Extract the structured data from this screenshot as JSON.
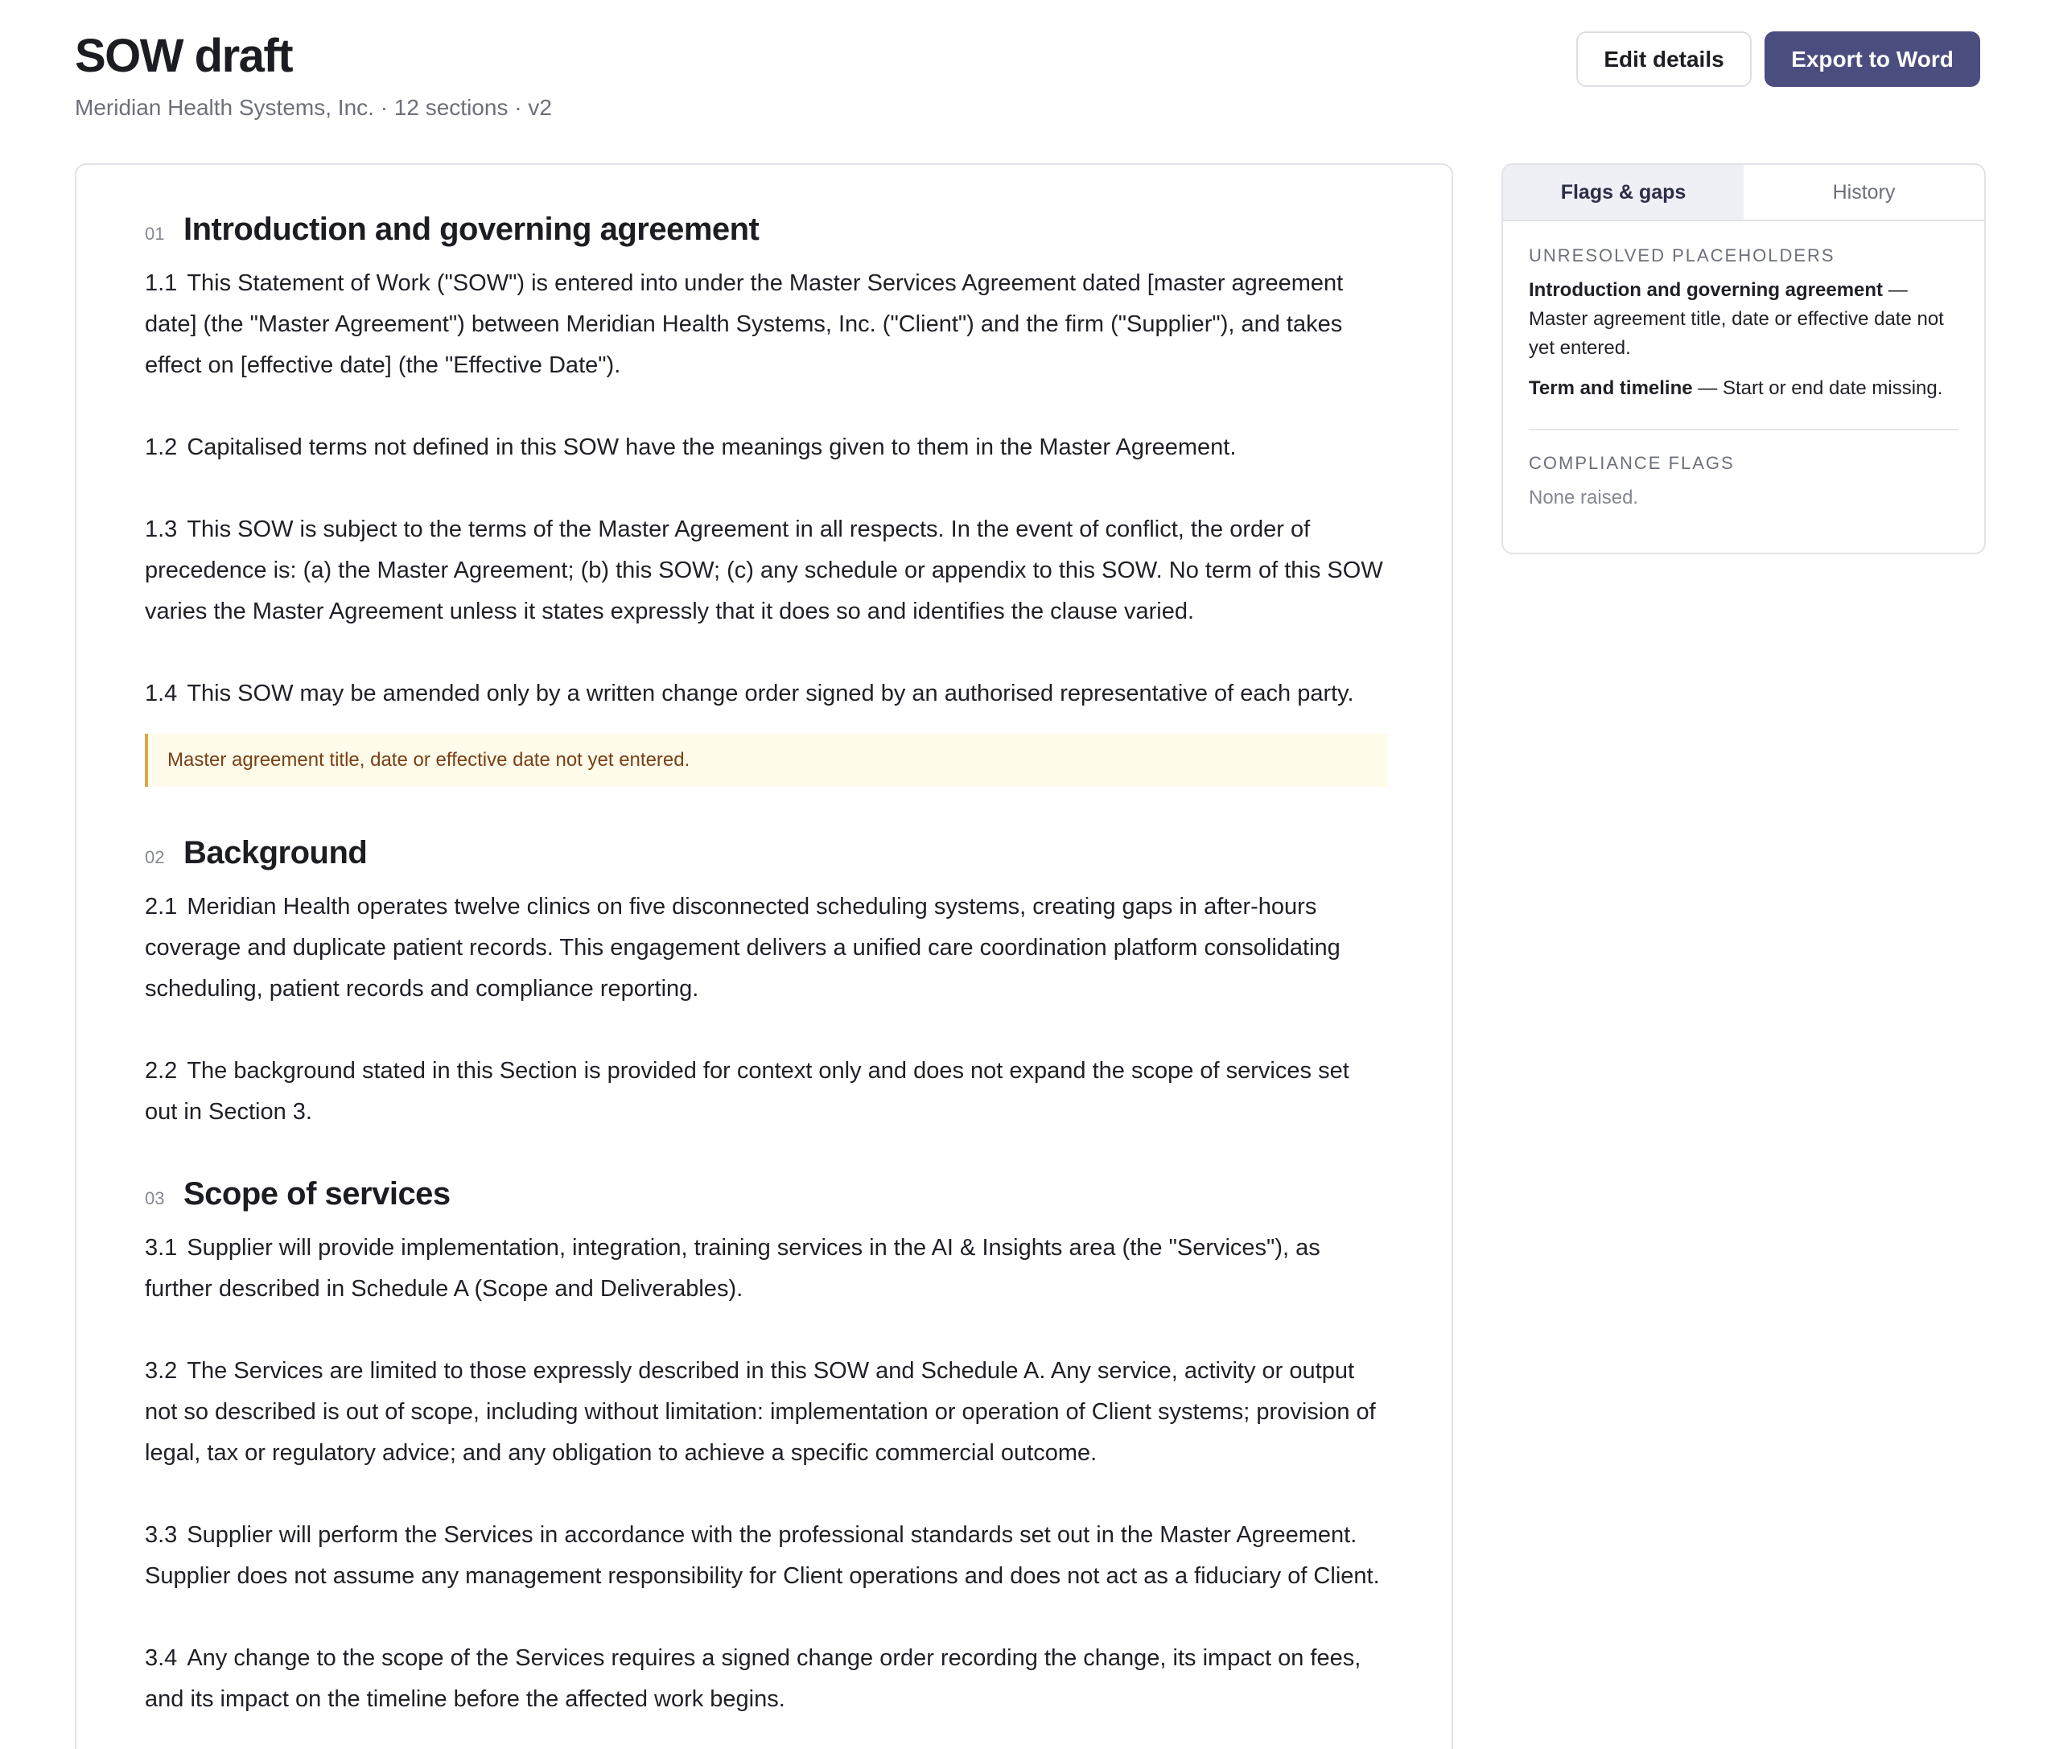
{
  "header": {
    "title": "SOW draft",
    "subtitle": "Meridian Health Systems, Inc. · 12 sections · v2",
    "edit_label": "Edit details",
    "export_label": "Export to Word"
  },
  "sections": [
    {
      "num": "01",
      "title": "Introduction and governing agreement",
      "clauses": [
        {
          "num": "1.1",
          "text": "This Statement of Work (\"SOW\") is entered into under the Master Services Agreement dated [master agreement date] (the \"Master Agreement\") between Meridian Health Systems, Inc. (\"Client\") and the firm (\"Supplier\"), and takes effect on [effective date] (the \"Effective Date\")."
        },
        {
          "num": "1.2",
          "text": "Capitalised terms not defined in this SOW have the meanings given to them in the Master Agreement."
        },
        {
          "num": "1.3",
          "text": "This SOW is subject to the terms of the Master Agreement in all respects. In the event of conflict, the order of precedence is: (a) the Master Agreement; (b) this SOW; (c) any schedule or appendix to this SOW. No term of this SOW varies the Master Agreement unless it states expressly that it does so and identifies the clause varied."
        },
        {
          "num": "1.4",
          "text": "This SOW may be amended only by a written change order signed by an authorised representative of each party."
        }
      ],
      "flag": "Master agreement title, date or effective date not yet entered."
    },
    {
      "num": "02",
      "title": "Background",
      "clauses": [
        {
          "num": "2.1",
          "text": "Meridian Health operates twelve clinics on five disconnected scheduling systems, creating gaps in after-hours coverage and duplicate patient records. This engagement delivers a unified care coordination platform consolidating scheduling, patient records and compliance reporting."
        },
        {
          "num": "2.2",
          "text": "The background stated in this Section is provided for context only and does not expand the scope of services set out in Section 3."
        }
      ]
    },
    {
      "num": "03",
      "title": "Scope of services",
      "clauses": [
        {
          "num": "3.1",
          "text": "Supplier will provide implementation, integration, training services in the AI & Insights area (the \"Services\"), as further described in Schedule A (Scope and Deliverables)."
        },
        {
          "num": "3.2",
          "text": "The Services are limited to those expressly described in this SOW and Schedule A. Any service, activity or output not so described is out of scope, including without limitation: implementation or operation of Client systems; provision of legal, tax or regulatory advice; and any obligation to achieve a specific commercial outcome."
        },
        {
          "num": "3.3",
          "text": "Supplier will perform the Services in accordance with the professional standards set out in the Master Agreement. Supplier does not assume any management responsibility for Client operations and does not act as a fiduciary of Client."
        },
        {
          "num": "3.4",
          "text": "Any change to the scope of the Services requires a signed change order recording the change, its impact on fees, and its impact on the timeline before the affected work begins."
        }
      ]
    }
  ],
  "panel": {
    "tabs": [
      "Flags & gaps",
      "History"
    ],
    "active_tab": "Flags & gaps",
    "placeholders_label": "Unresolved placeholders",
    "placeholders": [
      {
        "section": "Introduction and governing agreement",
        "note": "— Master agreement title, date or effective date not yet entered."
      },
      {
        "section": "Term and timeline",
        "note": "— Start or end date missing."
      }
    ],
    "compliance_label": "Compliance flags",
    "compliance_value": "None raised."
  },
  "colors": {
    "accent": "#4b4d7f",
    "flag_bg": "#fffbea",
    "flag_border": "#d9a84a",
    "flag_text": "#7a3f14"
  }
}
